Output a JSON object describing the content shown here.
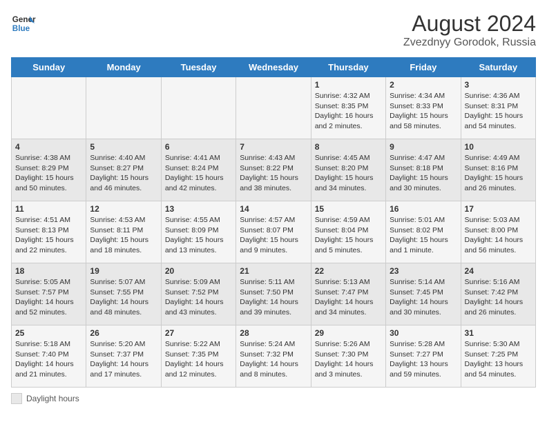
{
  "logo": {
    "line1": "General",
    "line2": "Blue"
  },
  "title": "August 2024",
  "subtitle": "Zvezdnyy Gorodok, Russia",
  "days_of_week": [
    "Sunday",
    "Monday",
    "Tuesday",
    "Wednesday",
    "Thursday",
    "Friday",
    "Saturday"
  ],
  "weeks": [
    [
      {
        "day": "",
        "info": ""
      },
      {
        "day": "",
        "info": ""
      },
      {
        "day": "",
        "info": ""
      },
      {
        "day": "",
        "info": ""
      },
      {
        "day": "1",
        "info": "Sunrise: 4:32 AM\nSunset: 8:35 PM\nDaylight: 16 hours\nand 2 minutes."
      },
      {
        "day": "2",
        "info": "Sunrise: 4:34 AM\nSunset: 8:33 PM\nDaylight: 15 hours\nand 58 minutes."
      },
      {
        "day": "3",
        "info": "Sunrise: 4:36 AM\nSunset: 8:31 PM\nDaylight: 15 hours\nand 54 minutes."
      }
    ],
    [
      {
        "day": "4",
        "info": "Sunrise: 4:38 AM\nSunset: 8:29 PM\nDaylight: 15 hours\nand 50 minutes."
      },
      {
        "day": "5",
        "info": "Sunrise: 4:40 AM\nSunset: 8:27 PM\nDaylight: 15 hours\nand 46 minutes."
      },
      {
        "day": "6",
        "info": "Sunrise: 4:41 AM\nSunset: 8:24 PM\nDaylight: 15 hours\nand 42 minutes."
      },
      {
        "day": "7",
        "info": "Sunrise: 4:43 AM\nSunset: 8:22 PM\nDaylight: 15 hours\nand 38 minutes."
      },
      {
        "day": "8",
        "info": "Sunrise: 4:45 AM\nSunset: 8:20 PM\nDaylight: 15 hours\nand 34 minutes."
      },
      {
        "day": "9",
        "info": "Sunrise: 4:47 AM\nSunset: 8:18 PM\nDaylight: 15 hours\nand 30 minutes."
      },
      {
        "day": "10",
        "info": "Sunrise: 4:49 AM\nSunset: 8:16 PM\nDaylight: 15 hours\nand 26 minutes."
      }
    ],
    [
      {
        "day": "11",
        "info": "Sunrise: 4:51 AM\nSunset: 8:13 PM\nDaylight: 15 hours\nand 22 minutes."
      },
      {
        "day": "12",
        "info": "Sunrise: 4:53 AM\nSunset: 8:11 PM\nDaylight: 15 hours\nand 18 minutes."
      },
      {
        "day": "13",
        "info": "Sunrise: 4:55 AM\nSunset: 8:09 PM\nDaylight: 15 hours\nand 13 minutes."
      },
      {
        "day": "14",
        "info": "Sunrise: 4:57 AM\nSunset: 8:07 PM\nDaylight: 15 hours\nand 9 minutes."
      },
      {
        "day": "15",
        "info": "Sunrise: 4:59 AM\nSunset: 8:04 PM\nDaylight: 15 hours\nand 5 minutes."
      },
      {
        "day": "16",
        "info": "Sunrise: 5:01 AM\nSunset: 8:02 PM\nDaylight: 15 hours\nand 1 minute."
      },
      {
        "day": "17",
        "info": "Sunrise: 5:03 AM\nSunset: 8:00 PM\nDaylight: 14 hours\nand 56 minutes."
      }
    ],
    [
      {
        "day": "18",
        "info": "Sunrise: 5:05 AM\nSunset: 7:57 PM\nDaylight: 14 hours\nand 52 minutes."
      },
      {
        "day": "19",
        "info": "Sunrise: 5:07 AM\nSunset: 7:55 PM\nDaylight: 14 hours\nand 48 minutes."
      },
      {
        "day": "20",
        "info": "Sunrise: 5:09 AM\nSunset: 7:52 PM\nDaylight: 14 hours\nand 43 minutes."
      },
      {
        "day": "21",
        "info": "Sunrise: 5:11 AM\nSunset: 7:50 PM\nDaylight: 14 hours\nand 39 minutes."
      },
      {
        "day": "22",
        "info": "Sunrise: 5:13 AM\nSunset: 7:47 PM\nDaylight: 14 hours\nand 34 minutes."
      },
      {
        "day": "23",
        "info": "Sunrise: 5:14 AM\nSunset: 7:45 PM\nDaylight: 14 hours\nand 30 minutes."
      },
      {
        "day": "24",
        "info": "Sunrise: 5:16 AM\nSunset: 7:42 PM\nDaylight: 14 hours\nand 26 minutes."
      }
    ],
    [
      {
        "day": "25",
        "info": "Sunrise: 5:18 AM\nSunset: 7:40 PM\nDaylight: 14 hours\nand 21 minutes."
      },
      {
        "day": "26",
        "info": "Sunrise: 5:20 AM\nSunset: 7:37 PM\nDaylight: 14 hours\nand 17 minutes."
      },
      {
        "day": "27",
        "info": "Sunrise: 5:22 AM\nSunset: 7:35 PM\nDaylight: 14 hours\nand 12 minutes."
      },
      {
        "day": "28",
        "info": "Sunrise: 5:24 AM\nSunset: 7:32 PM\nDaylight: 14 hours\nand 8 minutes."
      },
      {
        "day": "29",
        "info": "Sunrise: 5:26 AM\nSunset: 7:30 PM\nDaylight: 14 hours\nand 3 minutes."
      },
      {
        "day": "30",
        "info": "Sunrise: 5:28 AM\nSunset: 7:27 PM\nDaylight: 13 hours\nand 59 minutes."
      },
      {
        "day": "31",
        "info": "Sunrise: 5:30 AM\nSunset: 7:25 PM\nDaylight: 13 hours\nand 54 minutes."
      }
    ]
  ],
  "footer": {
    "daylight_label": "Daylight hours"
  },
  "colors": {
    "header_bg": "#2e7bbf",
    "odd_row": "#f5f5f5",
    "even_row": "#e8e8e8"
  }
}
